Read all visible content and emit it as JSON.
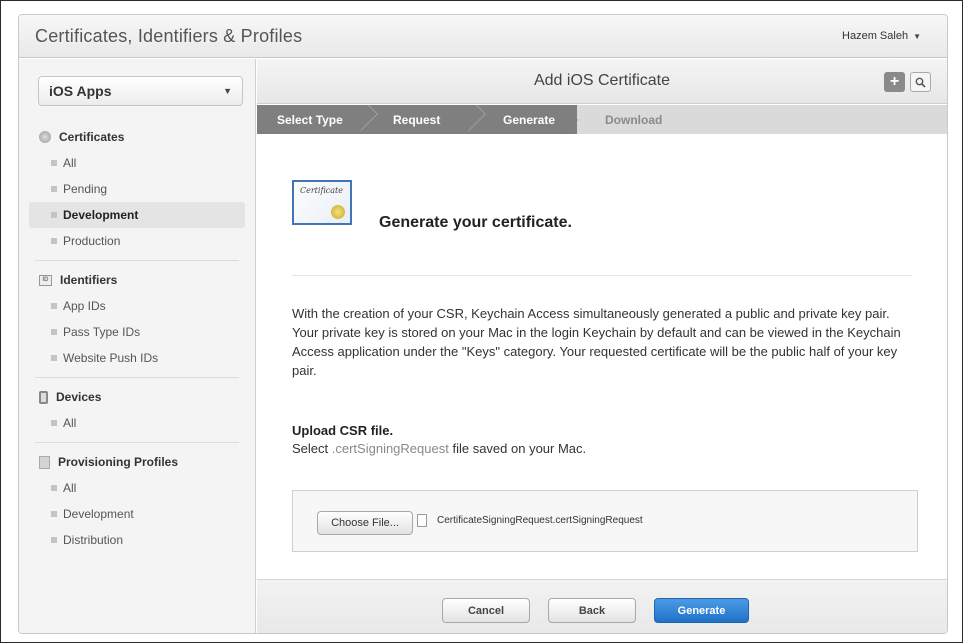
{
  "app": {
    "title": "Certificates, Identifiers & Profiles",
    "user": "Hazem Saleh"
  },
  "sidebar": {
    "platform": "iOS Apps",
    "sections": [
      {
        "title": "Certificates",
        "icon": "certificate-icon",
        "items": [
          "All",
          "Pending",
          "Development",
          "Production"
        ],
        "active": "Development"
      },
      {
        "title": "Identifiers",
        "icon": "id-icon",
        "items": [
          "App IDs",
          "Pass Type IDs",
          "Website Push IDs"
        ]
      },
      {
        "title": "Devices",
        "icon": "device-icon",
        "items": [
          "All"
        ]
      },
      {
        "title": "Provisioning Profiles",
        "icon": "profile-icon",
        "items": [
          "All",
          "Development",
          "Distribution"
        ]
      }
    ]
  },
  "main": {
    "title": "Add iOS Certificate",
    "steps": [
      "Select Type",
      "Request",
      "Generate",
      "Download"
    ],
    "current_step": "Generate",
    "cert_badge_text": "Certificate",
    "heading": "Generate your certificate.",
    "description": "With the creation of your CSR, Keychain Access simultaneously generated a public and private key pair. Your private key is stored on your Mac in the login Keychain by default and can be viewed in the Keychain Access application under the \"Keys\" category. Your requested certificate will be the public half of your key pair.",
    "upload_title": "Upload CSR file.",
    "upload_sub_prefix": "Select",
    "upload_sub_ext": ".certSigningRequest",
    "upload_sub_suffix": "file saved on your Mac.",
    "choose_file_label": "Choose File...",
    "file_name": "CertificateSigningRequest.certSigningRequest"
  },
  "footer": {
    "cancel": "Cancel",
    "back": "Back",
    "generate": "Generate"
  },
  "colors": {
    "accent": "#1f72c8",
    "step_done": "#7f7f7f",
    "step_pending": "#dadada"
  }
}
